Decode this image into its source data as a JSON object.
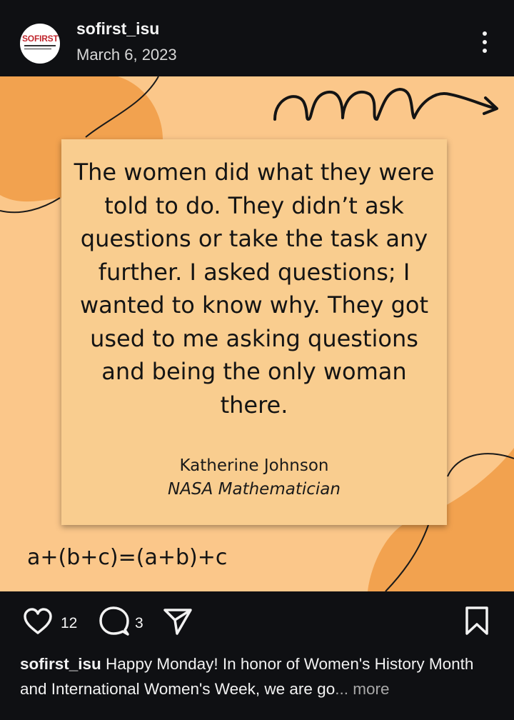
{
  "post": {
    "username": "sofirst_isu",
    "date": "March 6, 2023",
    "avatar_logo": "SOFIRST"
  },
  "quote": {
    "text": "The women did what they were told to do. They didn’t ask questions or take the task any further. I asked questions; I wanted to know why. They got used to me asking questions and being the only woman there.",
    "author": "Katherine Johnson",
    "role": "NASA Mathematician"
  },
  "equation": "a+(b+c)=(a+b)+c",
  "actions": {
    "like_count": "12",
    "comment_count": "3"
  },
  "caption": {
    "username": "sofirst_isu",
    "text": " Happy Monday! In honor of Women's History Month and International Women's Week, we are go",
    "ellipsis": "...",
    "more": " more"
  },
  "icons": [
    "more-vertical-icon",
    "heart-icon",
    "comment-icon",
    "share-icon",
    "bookmark-icon",
    "squiggle-arrow-icon"
  ],
  "colors": {
    "background": "#0f1013",
    "post_bg": "#fbc78a",
    "blob": "#f2a24f",
    "card": "#f9cd8f",
    "text": "#f4f4f4"
  }
}
